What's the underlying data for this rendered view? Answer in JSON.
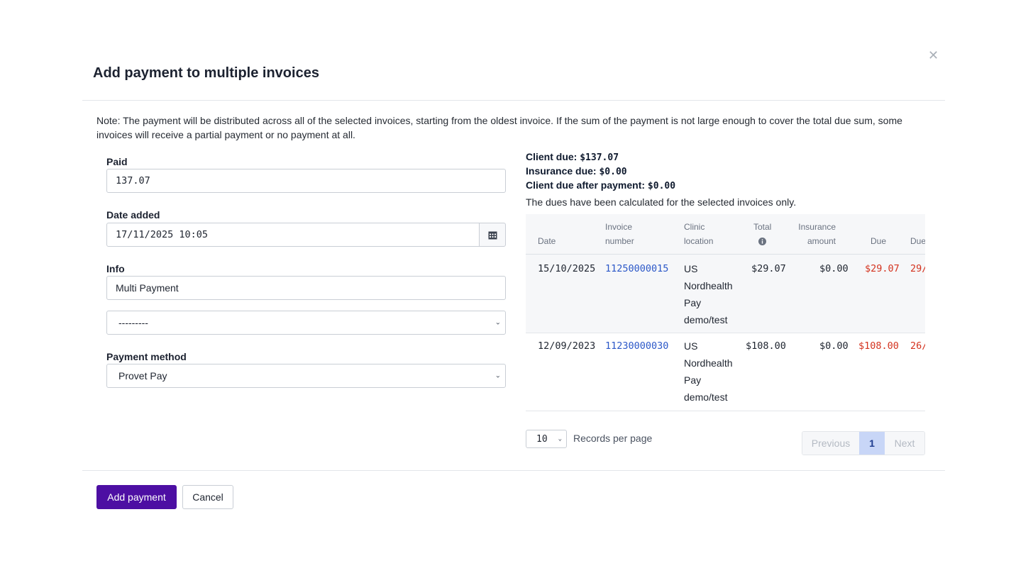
{
  "dialog": {
    "title": "Add payment to multiple invoices",
    "note": "Note: The payment will be distributed across all of the selected invoices, starting from the oldest invoice. If the sum of the payment is not large enough to cover the total due sum, some invoices will receive a partial payment or no payment at all."
  },
  "form": {
    "paid_label": "Paid",
    "paid_value": "137.07",
    "date_label": "Date added",
    "date_value": "17/11/2025 10:05",
    "info_label": "Info",
    "info_value": "Multi Payment",
    "extra_select_value": "---------",
    "method_label": "Payment method",
    "method_value": "Provet Pay"
  },
  "summary": {
    "client_due_label": "Client due:",
    "client_due_value": "$137.07",
    "insurance_due_label": "Insurance due:",
    "insurance_due_value": "$0.00",
    "after_label": "Client due after payment:",
    "after_value": "$0.00",
    "calc_note": "The dues have been calculated for the selected invoices only."
  },
  "table": {
    "headers": {
      "date": "Date",
      "invoice_1": "Invoice",
      "invoice_2": "number",
      "clinic_1": "Clinic",
      "clinic_2": "location",
      "total": "Total",
      "insurance_1": "Insurance",
      "insurance_2": "amount",
      "due": "Due",
      "due_date": "Due"
    },
    "rows": [
      {
        "date": "15/10/2025",
        "invoice": "11250000015",
        "clinic": [
          "US",
          "Nordhealth",
          "Pay",
          "demo/test"
        ],
        "total": "$29.07",
        "insurance": "$0.00",
        "due": "$29.07",
        "due_date": "29/"
      },
      {
        "date": "12/09/2023",
        "invoice": "11230000030",
        "clinic": [
          "US",
          "Nordhealth",
          "Pay",
          "demo/test"
        ],
        "total": "$108.00",
        "insurance": "$0.00",
        "due": "$108.00",
        "due_date": "26/"
      }
    ]
  },
  "pagination": {
    "per_page_value": "10",
    "per_page_label": "Records per page",
    "previous": "Previous",
    "current": "1",
    "next": "Next"
  },
  "actions": {
    "add_payment": "Add payment",
    "cancel": "Cancel"
  },
  "colors": {
    "primary": "#4d0fa3",
    "link": "#2c58c8",
    "due_red": "#d4331f"
  }
}
